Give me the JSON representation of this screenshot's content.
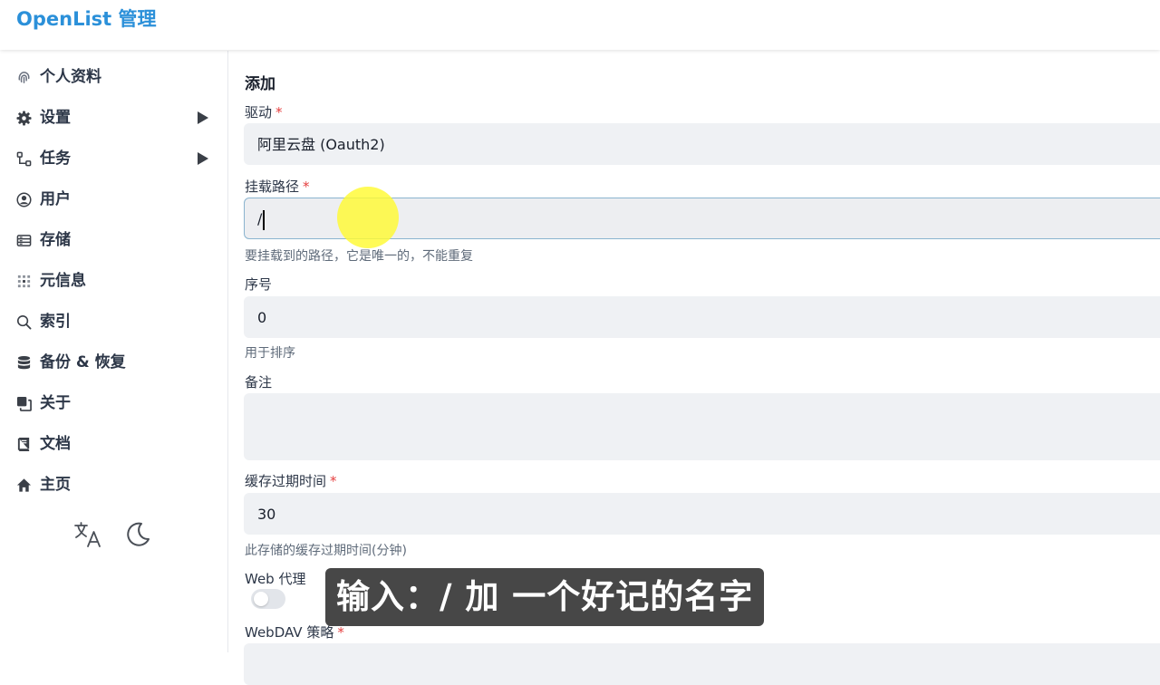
{
  "header": {
    "title": "OpenList 管理"
  },
  "sidebar": {
    "items": [
      {
        "label": "个人资料",
        "icon": "fingerprint-icon",
        "has_submenu": false
      },
      {
        "label": "设置",
        "icon": "gear-icon",
        "has_submenu": true
      },
      {
        "label": "任务",
        "icon": "task-flow-icon",
        "has_submenu": true
      },
      {
        "label": "用户",
        "icon": "user-circle-icon",
        "has_submenu": false
      },
      {
        "label": "存储",
        "icon": "storage-icon",
        "has_submenu": false
      },
      {
        "label": "元信息",
        "icon": "meta-grid-icon",
        "has_submenu": false
      },
      {
        "label": "索引",
        "icon": "search-icon",
        "has_submenu": false
      },
      {
        "label": "备份 & 恢复",
        "icon": "database-icon",
        "has_submenu": false
      },
      {
        "label": "关于",
        "icon": "copy-icon",
        "has_submenu": false
      },
      {
        "label": "文档",
        "icon": "book-icon",
        "has_submenu": false
      },
      {
        "label": "主页",
        "icon": "home-icon",
        "has_submenu": false
      }
    ],
    "tools": {
      "language_icon": "translate-icon",
      "theme_icon": "moon-icon"
    }
  },
  "form": {
    "title": "添加",
    "driver": {
      "label": "驱动",
      "required_mark": "*",
      "value": "阿里云盘 (Oauth2)"
    },
    "mount_path": {
      "label": "挂载路径",
      "required_mark": "*",
      "value": "/",
      "help": "要挂载到的路径，它是唯一的，不能重复"
    },
    "order": {
      "label": "序号",
      "value": "0",
      "help": "用于排序"
    },
    "remark": {
      "label": "备注",
      "value": ""
    },
    "cache_expiration": {
      "label": "缓存过期时间",
      "required_mark": "*",
      "value": "30",
      "help": "此存储的缓存过期时间(分钟)"
    },
    "web_proxy": {
      "label": "Web 代理",
      "enabled": false
    },
    "webdav_policy": {
      "label": "WebDAV 策略",
      "required_mark": "*"
    }
  },
  "overlay": {
    "subtitle": "输入：/ 加 一个好记的名字",
    "highlight_color": "#fff932"
  },
  "colors": {
    "brand": "#2b90d9",
    "required": "#e53e3e",
    "field_bg": "#eff1f4"
  }
}
